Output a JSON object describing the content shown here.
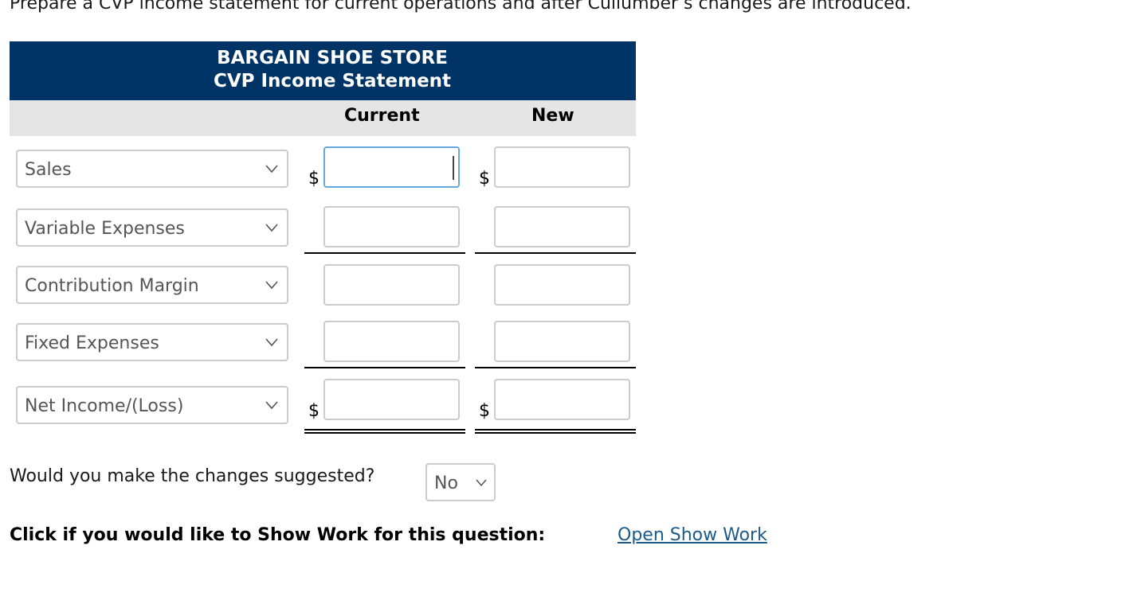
{
  "instructions": "Prepare a CVP income statement for current operations and after Cullumber’s changes are introduced.",
  "statement": {
    "company": "BARGAIN SHOE STORE",
    "title": "CVP Income Statement",
    "columns": {
      "current": "Current",
      "new": "New"
    },
    "currency_symbol": "$",
    "rows": [
      {
        "label": "Sales",
        "current_value": "",
        "new_value": ""
      },
      {
        "label": "Variable Expenses",
        "current_value": "",
        "new_value": ""
      },
      {
        "label": "Contribution Margin",
        "current_value": "",
        "new_value": ""
      },
      {
        "label": "Fixed Expenses",
        "current_value": "",
        "new_value": ""
      },
      {
        "label": "Net Income/(Loss)",
        "current_value": "",
        "new_value": ""
      }
    ]
  },
  "decision": {
    "question": "Would you make the changes suggested?",
    "selected": "No"
  },
  "show_work": {
    "prompt": "Click if you would like to Show Work for this question:",
    "link": "Open Show Work"
  },
  "colors": {
    "header_bg": "#003366",
    "subheader_bg": "#e5e5e5",
    "focus_border": "#66a9e0",
    "link": "#1c5a8a"
  }
}
